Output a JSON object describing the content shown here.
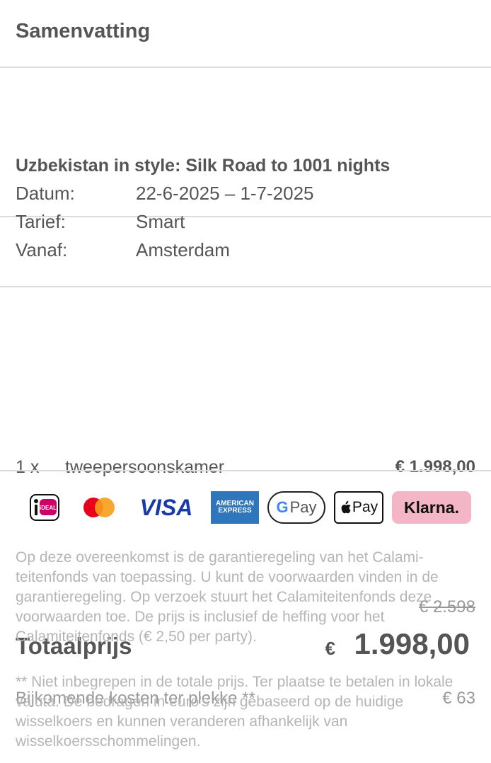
{
  "header": {
    "title": "Samenvatting"
  },
  "trip": {
    "title": "Uzbekistan in style: Silk Road to 1001 nights",
    "rows": [
      {
        "label": "Datum:",
        "value": "22-6-2025 – 1-7-2025"
      },
      {
        "label": "Tarief:",
        "value": "Smart"
      },
      {
        "label": "Vanaf:",
        "value": "Amsterdam"
      }
    ]
  },
  "room": {
    "quantity": "1 x",
    "name": "tweepersoonskamer",
    "price": "€ 1.998,00"
  },
  "total": {
    "old_price": "€ 2.598",
    "label": "Totaalprijs",
    "currency": "€",
    "amount": "1.998,00",
    "extra_label": "Bijkomende kosten ter plekke **",
    "extra_amount": "€ 63"
  },
  "payments": {
    "ideal_text": "iDEAL",
    "visa_text": "VISA",
    "amex_line1": "AMERICAN",
    "amex_line2": "EXPRESS",
    "gpay_text": "Pay",
    "gpay_g": "G",
    "apay_text": "Pay",
    "klarna_text": "Klarna.",
    "colors": {
      "mastercard_red": "#eb001b",
      "mastercard_orange": "#f79e1b",
      "klarna_pink": "#f4b6c7",
      "amex_blue": "#2e77bc",
      "visa_blue": "#1a3ba7"
    }
  },
  "disclaimers": {
    "calamiteiten": "Op deze overeenkomst is de garantieregeling van het Calami­teitenfonds van toepassing. U kunt de voorwaarden vinden in de garantieregeling. Op verzoek stuurt het Calamiteitenfonds deze voorwaarden toe. De prijs is inclusief de heffing voor het Calamiteitenfonds (€ 2,50 per party).",
    "currency_note": "** Niet inbegrepen in de totale prijs. Ter plaatse te betalen in lokale valuta. De bedragen in euro's zijn gebaseerd op de huidi­ge wisselkoers en kunnen veranderen afhankelijk van wisselkoersschommelingen."
  }
}
